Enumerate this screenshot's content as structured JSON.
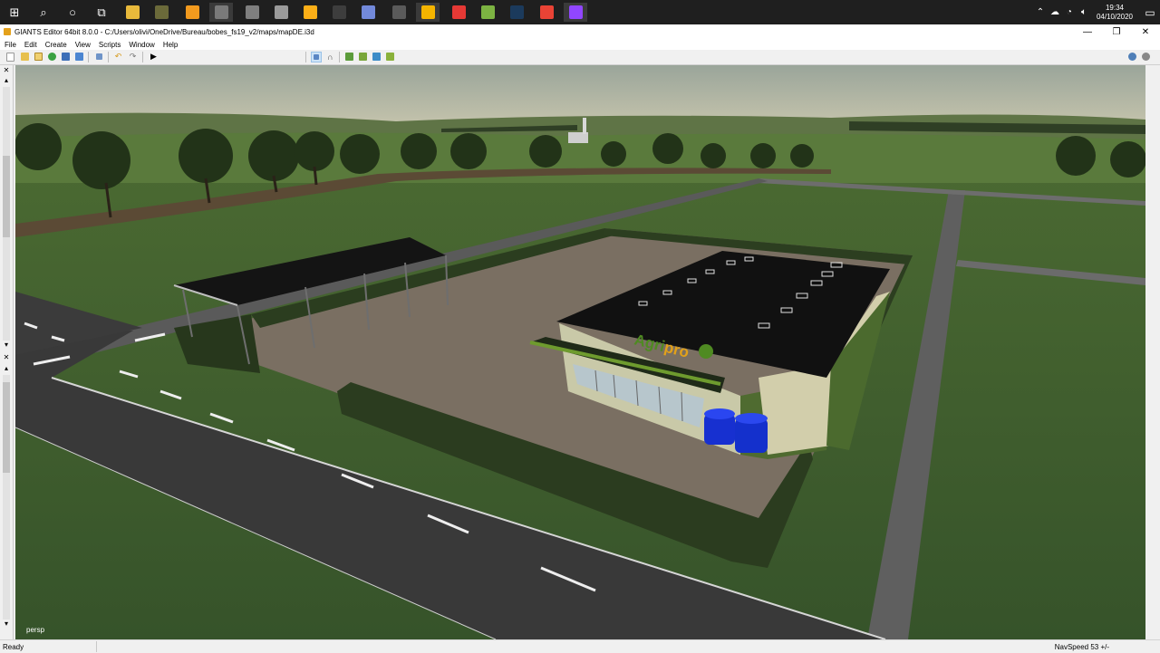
{
  "taskbar": {
    "pinned": [
      {
        "name": "start-icon",
        "color": "#ffffff",
        "glyph": "⊞"
      },
      {
        "name": "search-icon",
        "color": "#ffffff",
        "glyph": "⌕"
      },
      {
        "name": "cortana-icon",
        "color": "#ffffff",
        "glyph": "○"
      },
      {
        "name": "task-view-icon",
        "color": "#ffffff",
        "glyph": "⧉"
      },
      {
        "name": "file-explorer-icon",
        "color": "#e8b93b"
      },
      {
        "name": "farming-simulator-icon",
        "color": "#6b6a3a"
      },
      {
        "name": "orange-app-icon",
        "color": "#f29a1e"
      },
      {
        "name": "giants-editor-icon",
        "color": "#7a7a7a",
        "active": true
      },
      {
        "name": "game-app-icon",
        "color": "#7f7f7f"
      },
      {
        "name": "war-game-icon",
        "color": "#9a9a9a"
      },
      {
        "name": "rockstar-icon",
        "color": "#fcaf17"
      },
      {
        "name": "obs-icon",
        "color": "#3d3d3d"
      },
      {
        "name": "discord-icon",
        "color": "#7289da"
      },
      {
        "name": "world-of-tanks-icon",
        "color": "#5a5a5a"
      },
      {
        "name": "google-slides-icon",
        "color": "#f4b400",
        "active": true
      },
      {
        "name": "red-app-icon",
        "color": "#e53935"
      },
      {
        "name": "minecraft-icon",
        "color": "#7cb342"
      },
      {
        "name": "steam-icon",
        "color": "#1b3a5c"
      },
      {
        "name": "chrome-icon",
        "color": "#e94335"
      },
      {
        "name": "twitch-icon",
        "color": "#9146ff",
        "active": true
      }
    ],
    "clock_time": "19:34",
    "clock_date": "04/10/2020"
  },
  "window": {
    "title": "GIANTS Editor 64bit 8.0.0 - C:/Users/olivi/OneDrive/Bureau/bobes_fs19_v2/maps/mapDE.i3d",
    "minimize_glyph": "—",
    "maximize_glyph": "❐",
    "close_glyph": "✕"
  },
  "menu": {
    "file": "File",
    "edit": "Edit",
    "create": "Create",
    "view": "View",
    "scripts": "Scripts",
    "window": "Window",
    "help": "Help"
  },
  "viewport": {
    "camera_mode": "persp",
    "sign_text_a": "Agri",
    "sign_text_b": "pro"
  },
  "status": {
    "text": "Ready",
    "navspeed": "NavSpeed 53 +/-"
  }
}
